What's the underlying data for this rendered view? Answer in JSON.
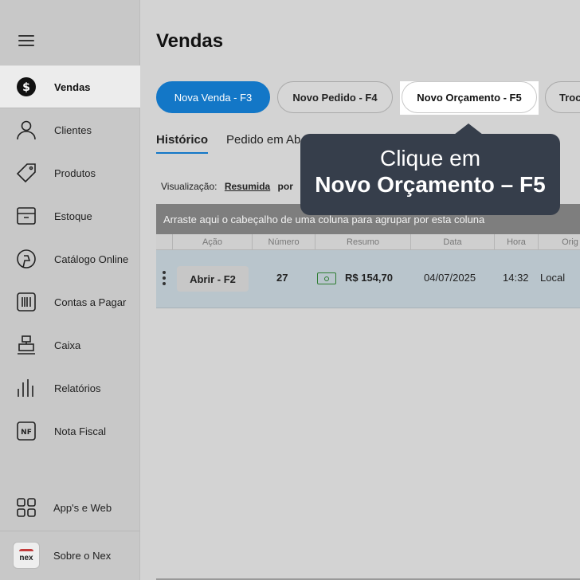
{
  "sidebar": {
    "items": [
      {
        "label": "Vendas",
        "icon": "dollar-icon",
        "active": true
      },
      {
        "label": "Clientes",
        "icon": "user-icon"
      },
      {
        "label": "Produtos",
        "icon": "tag-icon"
      },
      {
        "label": "Estoque",
        "icon": "box-icon"
      },
      {
        "label": "Catálogo Online",
        "icon": "catalog-icon"
      },
      {
        "label": "Contas a Pagar",
        "icon": "barcode-icon"
      },
      {
        "label": "Caixa",
        "icon": "cash-register-icon"
      },
      {
        "label": "Relatórios",
        "icon": "chart-bars-icon"
      },
      {
        "label": "Nota Fiscal",
        "icon": "nf-icon",
        "icon_text": "NF"
      }
    ],
    "apps": {
      "label": "App's e Web",
      "icon": "grid-apps-icon"
    },
    "about": {
      "label": "Sobre o Nex",
      "icon": "nex-logo-icon",
      "logo_text": "nex"
    }
  },
  "main": {
    "title": "Vendas",
    "buttons": {
      "nova_venda": "Nova Venda - F3",
      "novo_pedido": "Novo Pedido - F4",
      "novo_orcamento": "Novo Orçamento - F5",
      "troca": "Troc"
    },
    "tabs": [
      {
        "label": "Histórico",
        "active": true
      },
      {
        "label": "Pedido em Ab"
      }
    ],
    "visualizacao": {
      "label": "Visualização:",
      "value": "Resumida",
      "por": "por"
    },
    "group_bar_text": "Arraste aqui o cabeçalho de uma coluna para agrupar por esta coluna",
    "columns": [
      "Ação",
      "Número",
      "Resumo",
      "Data",
      "Hora",
      "Orig"
    ],
    "rows": [
      {
        "action": "Abrir - F2",
        "numero": "27",
        "resumo": "R$ 154,70",
        "data": "04/07/2025",
        "hora": "14:32",
        "origem": "Local"
      }
    ]
  },
  "tooltip": {
    "line1": "Clique em",
    "line2": "Novo Orçamento – F5"
  },
  "colors": {
    "primary": "#1377c7",
    "tooltip_bg": "#363e4b",
    "row_selected": "#b9c5cc",
    "money_green": "#2e7d32"
  }
}
